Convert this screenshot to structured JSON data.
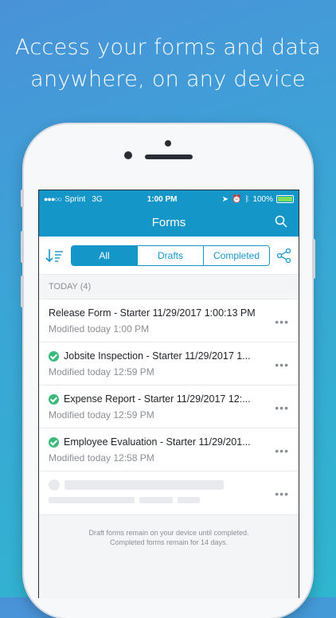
{
  "headline": {
    "line1": "Access your forms and data",
    "line2": "anywhere, on any device"
  },
  "status_bar": {
    "carrier": "Sprint",
    "network": "3G",
    "time": "1:00 PM",
    "battery": "100%"
  },
  "nav": {
    "title": "Forms"
  },
  "filters": {
    "tabs": [
      "All",
      "Drafts",
      "Completed"
    ],
    "selected": "All"
  },
  "section": {
    "label": "TODAY (4)"
  },
  "forms": [
    {
      "title": "Release Form - Starter 11/29/2017 1:00:13 PM",
      "modified": "Modified today 1:00 PM",
      "completed": false
    },
    {
      "title": "Jobsite Inspection - Starter 11/29/2017 1...",
      "modified": "Modified today 12:59 PM",
      "completed": true
    },
    {
      "title": "Expense Report - Starter 11/29/2017 12:...",
      "modified": "Modified today 12:59 PM",
      "completed": true
    },
    {
      "title": "Employee Evaluation - Starter 11/29/201...",
      "modified": "Modified today 12:58 PM",
      "completed": true
    }
  ],
  "footer": {
    "line1": "Draft forms remain on your device until completed.",
    "line2": "Completed forms remain for 14 days."
  },
  "colors": {
    "accent": "#1596c9",
    "success": "#3cba7a"
  },
  "icons": [
    "search-icon",
    "sort-icon",
    "share-icon",
    "check-icon",
    "more-icon",
    "location-icon",
    "bluetooth-icon",
    "alarm-icon",
    "battery-icon"
  ]
}
